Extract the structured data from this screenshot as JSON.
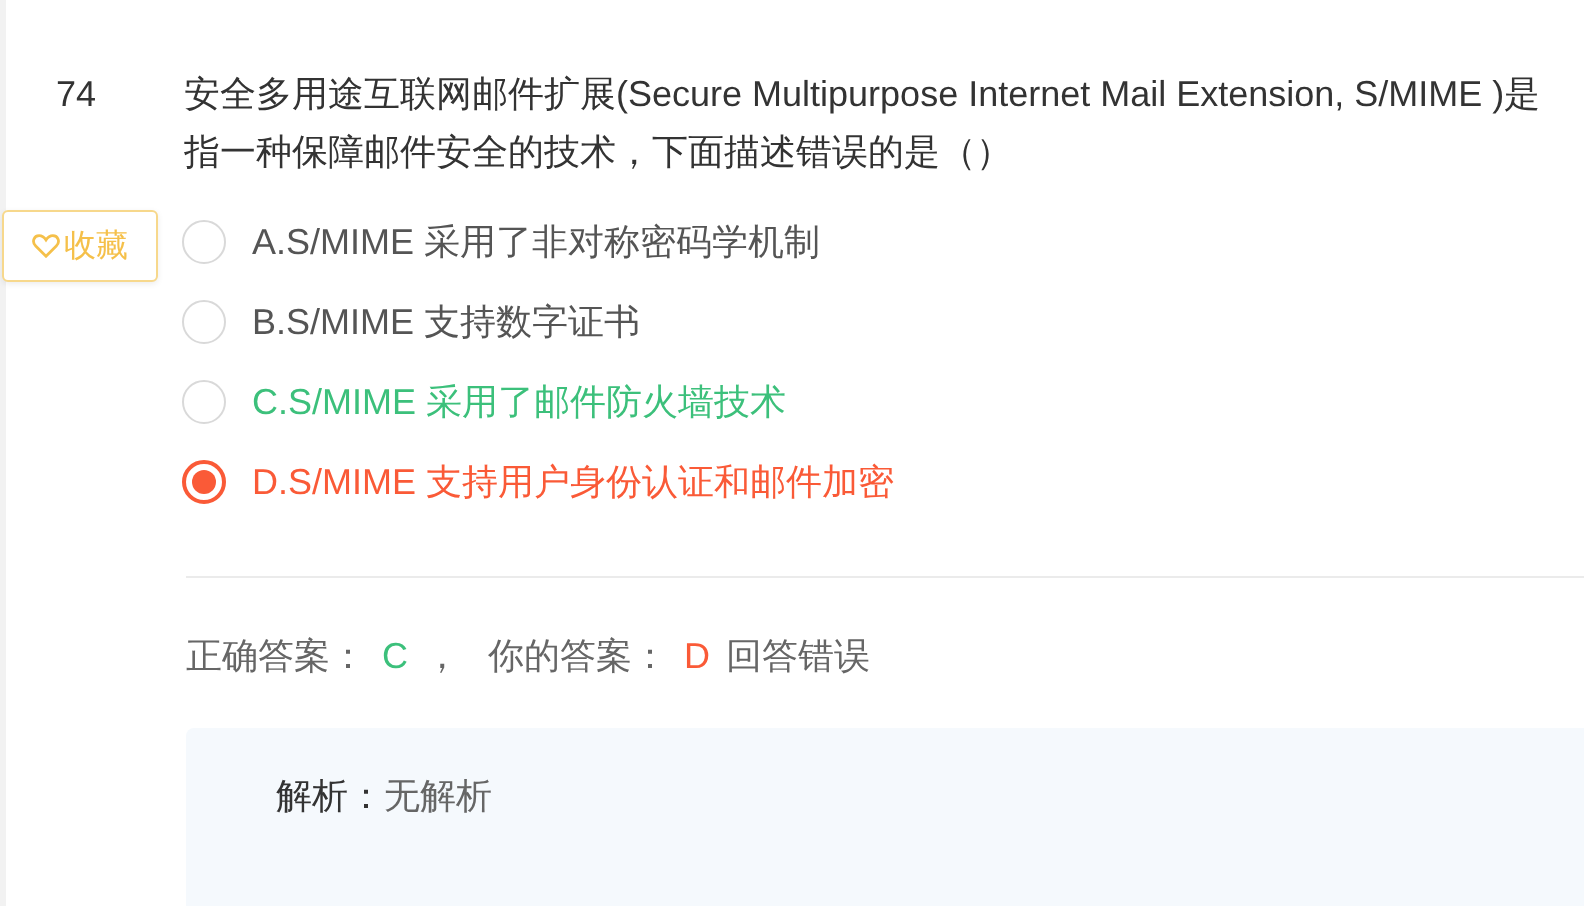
{
  "question": {
    "number": "74",
    "text": "安全多用途互联网邮件扩展(Secure Multipurpose Internet Mail Extension, S/MIME )是指一种保障邮件安全的技术，下面描述错误的是（）"
  },
  "favorite_button": {
    "label": "收藏"
  },
  "options": [
    {
      "label": "A.S/MIME 采用了非对称密码学机制",
      "selected": false,
      "correct": false
    },
    {
      "label": "B.S/MIME 支持数字证书",
      "selected": false,
      "correct": false
    },
    {
      "label": "C.S/MIME 采用了邮件防火墙技术",
      "selected": false,
      "correct": true
    },
    {
      "label": "D.S/MIME 支持用户身份认证和邮件加密",
      "selected": true,
      "correct": false
    }
  ],
  "result": {
    "correct_label": "正确答案：",
    "correct_answer": "C",
    "separator": "，",
    "your_label": "你的答案：",
    "your_answer": "D",
    "verdict": "回答错误"
  },
  "analysis": {
    "label": "解析：",
    "text": "无解析"
  }
}
